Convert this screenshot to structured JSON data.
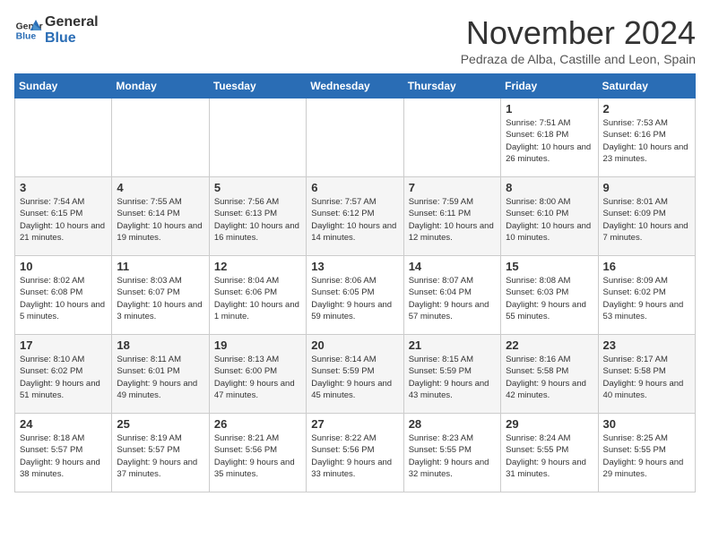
{
  "header": {
    "logo_general": "General",
    "logo_blue": "Blue",
    "month_title": "November 2024",
    "location": "Pedraza de Alba, Castille and Leon, Spain"
  },
  "days_of_week": [
    "Sunday",
    "Monday",
    "Tuesday",
    "Wednesday",
    "Thursday",
    "Friday",
    "Saturday"
  ],
  "weeks": [
    [
      null,
      null,
      null,
      null,
      null,
      {
        "day": 1,
        "sunrise": "7:51 AM",
        "sunset": "6:18 PM",
        "daylight": "10 hours and 26 minutes."
      },
      {
        "day": 2,
        "sunrise": "7:53 AM",
        "sunset": "6:16 PM",
        "daylight": "10 hours and 23 minutes."
      }
    ],
    [
      {
        "day": 3,
        "sunrise": "7:54 AM",
        "sunset": "6:15 PM",
        "daylight": "10 hours and 21 minutes."
      },
      {
        "day": 4,
        "sunrise": "7:55 AM",
        "sunset": "6:14 PM",
        "daylight": "10 hours and 19 minutes."
      },
      {
        "day": 5,
        "sunrise": "7:56 AM",
        "sunset": "6:13 PM",
        "daylight": "10 hours and 16 minutes."
      },
      {
        "day": 6,
        "sunrise": "7:57 AM",
        "sunset": "6:12 PM",
        "daylight": "10 hours and 14 minutes."
      },
      {
        "day": 7,
        "sunrise": "7:59 AM",
        "sunset": "6:11 PM",
        "daylight": "10 hours and 12 minutes."
      },
      {
        "day": 8,
        "sunrise": "8:00 AM",
        "sunset": "6:10 PM",
        "daylight": "10 hours and 10 minutes."
      },
      {
        "day": 9,
        "sunrise": "8:01 AM",
        "sunset": "6:09 PM",
        "daylight": "10 hours and 7 minutes."
      }
    ],
    [
      {
        "day": 10,
        "sunrise": "8:02 AM",
        "sunset": "6:08 PM",
        "daylight": "10 hours and 5 minutes."
      },
      {
        "day": 11,
        "sunrise": "8:03 AM",
        "sunset": "6:07 PM",
        "daylight": "10 hours and 3 minutes."
      },
      {
        "day": 12,
        "sunrise": "8:04 AM",
        "sunset": "6:06 PM",
        "daylight": "10 hours and 1 minute."
      },
      {
        "day": 13,
        "sunrise": "8:06 AM",
        "sunset": "6:05 PM",
        "daylight": "9 hours and 59 minutes."
      },
      {
        "day": 14,
        "sunrise": "8:07 AM",
        "sunset": "6:04 PM",
        "daylight": "9 hours and 57 minutes."
      },
      {
        "day": 15,
        "sunrise": "8:08 AM",
        "sunset": "6:03 PM",
        "daylight": "9 hours and 55 minutes."
      },
      {
        "day": 16,
        "sunrise": "8:09 AM",
        "sunset": "6:02 PM",
        "daylight": "9 hours and 53 minutes."
      }
    ],
    [
      {
        "day": 17,
        "sunrise": "8:10 AM",
        "sunset": "6:02 PM",
        "daylight": "9 hours and 51 minutes."
      },
      {
        "day": 18,
        "sunrise": "8:11 AM",
        "sunset": "6:01 PM",
        "daylight": "9 hours and 49 minutes."
      },
      {
        "day": 19,
        "sunrise": "8:13 AM",
        "sunset": "6:00 PM",
        "daylight": "9 hours and 47 minutes."
      },
      {
        "day": 20,
        "sunrise": "8:14 AM",
        "sunset": "5:59 PM",
        "daylight": "9 hours and 45 minutes."
      },
      {
        "day": 21,
        "sunrise": "8:15 AM",
        "sunset": "5:59 PM",
        "daylight": "9 hours and 43 minutes."
      },
      {
        "day": 22,
        "sunrise": "8:16 AM",
        "sunset": "5:58 PM",
        "daylight": "9 hours and 42 minutes."
      },
      {
        "day": 23,
        "sunrise": "8:17 AM",
        "sunset": "5:58 PM",
        "daylight": "9 hours and 40 minutes."
      }
    ],
    [
      {
        "day": 24,
        "sunrise": "8:18 AM",
        "sunset": "5:57 PM",
        "daylight": "9 hours and 38 minutes."
      },
      {
        "day": 25,
        "sunrise": "8:19 AM",
        "sunset": "5:57 PM",
        "daylight": "9 hours and 37 minutes."
      },
      {
        "day": 26,
        "sunrise": "8:21 AM",
        "sunset": "5:56 PM",
        "daylight": "9 hours and 35 minutes."
      },
      {
        "day": 27,
        "sunrise": "8:22 AM",
        "sunset": "5:56 PM",
        "daylight": "9 hours and 33 minutes."
      },
      {
        "day": 28,
        "sunrise": "8:23 AM",
        "sunset": "5:55 PM",
        "daylight": "9 hours and 32 minutes."
      },
      {
        "day": 29,
        "sunrise": "8:24 AM",
        "sunset": "5:55 PM",
        "daylight": "9 hours and 31 minutes."
      },
      {
        "day": 30,
        "sunrise": "8:25 AM",
        "sunset": "5:55 PM",
        "daylight": "9 hours and 29 minutes."
      }
    ]
  ]
}
